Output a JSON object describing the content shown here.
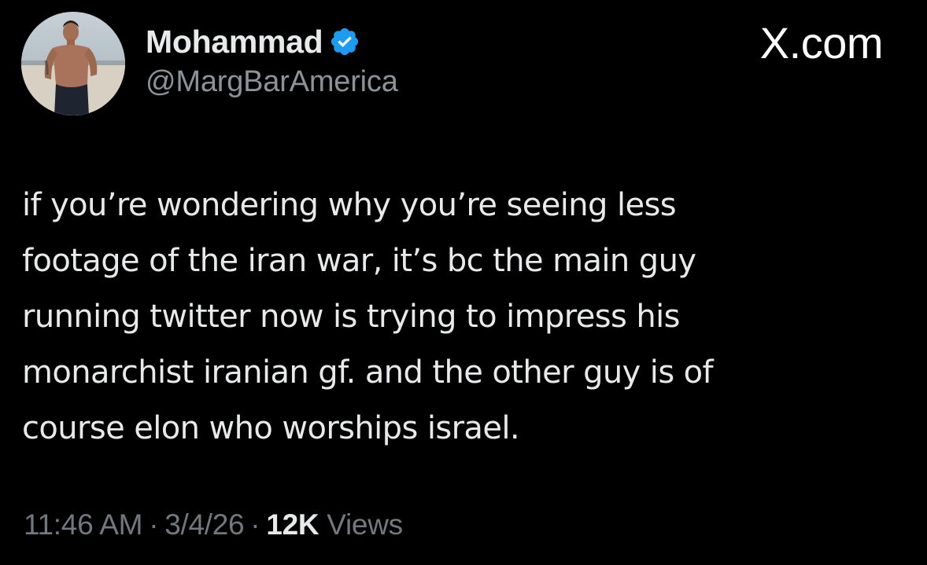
{
  "tweet": {
    "author": {
      "display_name": "Mohammad",
      "handle": "@MargBarAmerica",
      "verified": true,
      "verified_color": "#1d9bf0"
    },
    "source_label": "X.com",
    "text_lines": [
      "if you’re wondering why you’re seeing less",
      "footage of the iran war, it’s bc the main guy",
      "running twitter now is trying to impress his",
      "monarchist iranian gf. and the other guy is of",
      "course elon who worships israel."
    ],
    "meta": {
      "time": "11:46 AM",
      "separator": "·",
      "date": "3/4/26",
      "views_count": "12K",
      "views_label": "Views"
    }
  },
  "colors": {
    "background": "#000000",
    "primary_text": "#e7e9ea",
    "secondary_text": "#8b9298",
    "accent": "#1d9bf0"
  },
  "icons": {
    "verified": "verified-badge-icon",
    "avatar": "profile-photo"
  }
}
